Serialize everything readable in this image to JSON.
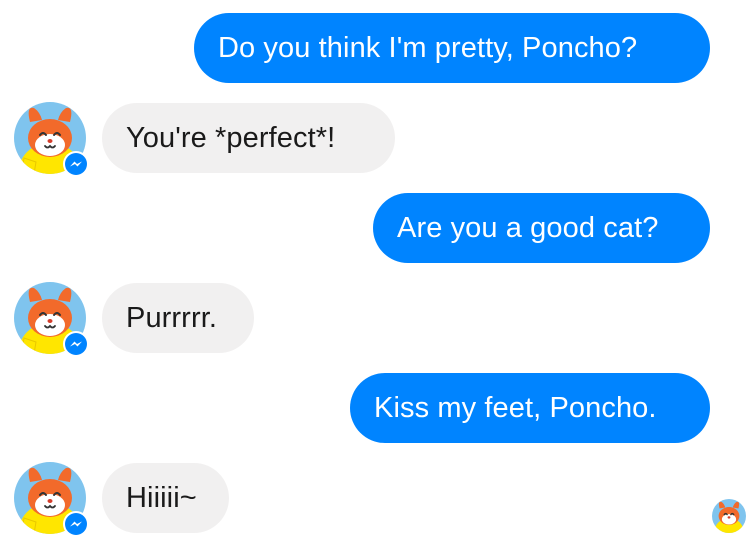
{
  "messages": [
    {
      "from": "user",
      "text": "Do you think I'm pretty, Poncho?"
    },
    {
      "from": "bot",
      "text": "You're *perfect*!"
    },
    {
      "from": "user",
      "text": "Are you a good cat?"
    },
    {
      "from": "bot",
      "text": "Purrrrr."
    },
    {
      "from": "user",
      "text": "Kiss my feet, Poncho."
    },
    {
      "from": "bot",
      "text": "Hiiiii~"
    }
  ],
  "colors": {
    "outgoing_bubble": "#0084ff",
    "incoming_bubble": "#f1f0f0",
    "avatar_background": "#7fc4ee",
    "cat_orange": "#f26a2b",
    "raincoat_yellow": "#ffe600",
    "messenger_blue": "#0084ff"
  },
  "icons": {
    "bot_avatar": "poncho-cat-avatar-icon",
    "badge": "messenger-badge-icon",
    "read_receipt": "seen-avatar-icon"
  }
}
